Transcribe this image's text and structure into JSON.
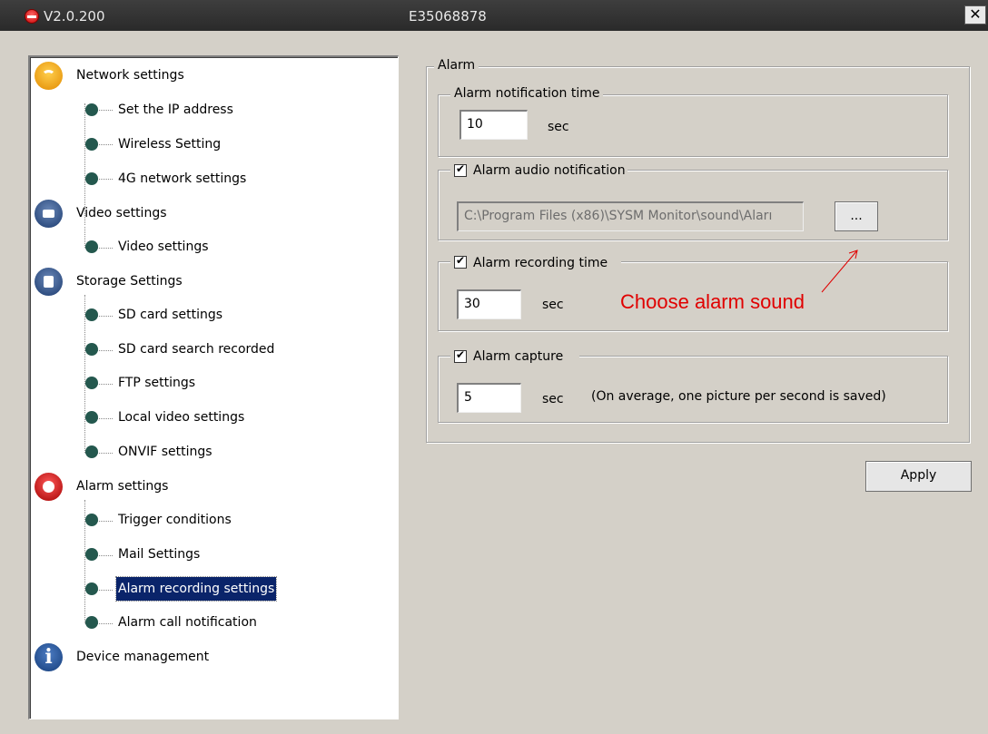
{
  "titlebar": {
    "version": "V2.0.200",
    "device_id": "E35068878",
    "close_label": "✕"
  },
  "tree": {
    "network": {
      "label": "Network settings",
      "items": [
        "Set the IP address",
        "Wireless Setting",
        "4G network settings"
      ]
    },
    "video": {
      "label": "Video settings",
      "items": [
        "Video settings"
      ]
    },
    "storage": {
      "label": "Storage Settings",
      "items": [
        "SD card settings",
        "SD card search recorded",
        "FTP settings",
        "Local video settings",
        "ONVIF settings"
      ]
    },
    "alarm": {
      "label": "Alarm settings",
      "items": [
        "Trigger conditions",
        "Mail Settings",
        "Alarm recording settings",
        "Alarm call notification"
      ],
      "selected": "Alarm recording settings"
    },
    "device": {
      "label": "Device management",
      "icon_glyph": "i"
    }
  },
  "alarm_panel": {
    "title": "Alarm",
    "notification_time": {
      "label": "Alarm notification time",
      "value": "10",
      "unit": "sec"
    },
    "audio_notification": {
      "label": "Alarm audio notification",
      "checked": true,
      "path": "C:\\Program Files (x86)\\SYSM Monitor\\sound\\Aları",
      "browse_label": "..."
    },
    "recording_time": {
      "label": "Alarm recording time",
      "checked": true,
      "value": "30",
      "unit": "sec"
    },
    "capture": {
      "label": "Alarm capture",
      "checked": true,
      "value": "5",
      "unit": "sec",
      "note": "(On average, one picture per second is saved)"
    },
    "apply_label": "Apply"
  },
  "annotation": {
    "text": "Choose alarm sound",
    "color": "#e00000"
  }
}
